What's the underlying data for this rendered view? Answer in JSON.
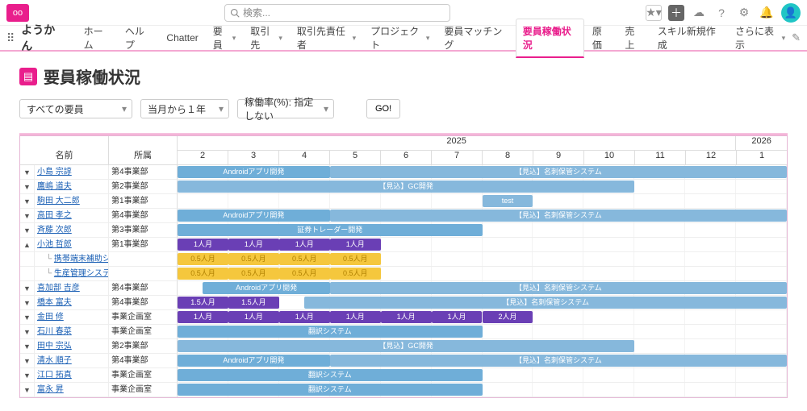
{
  "topbar": {
    "search_placeholder": "検索..."
  },
  "nav": {
    "app_name": "ようかん",
    "items": [
      "ホーム",
      "ヘルプ",
      "Chatter",
      "要員",
      "取引先",
      "取引先責任者",
      "プロジェクト",
      "要員マッチング",
      "要員稼働状況",
      "原価",
      "売上",
      "スキル新規作成",
      "さらに表示"
    ],
    "active_index": 8,
    "dropdown_indices": [
      3,
      4,
      5,
      6,
      12
    ]
  },
  "page_title": "要員稼働状況",
  "filters": {
    "resource": "すべての要員",
    "period": "当月から１年",
    "rate": "稼働率(%): 指定しない",
    "go_label": "GO!"
  },
  "columns": {
    "name": "名前",
    "dept": "所属"
  },
  "years": [
    {
      "label": "2025",
      "span": 11
    },
    {
      "label": "2026",
      "span": 1
    }
  ],
  "months": [
    "2",
    "3",
    "4",
    "5",
    "6",
    "7",
    "8",
    "9",
    "10",
    "11",
    "12",
    "1"
  ],
  "rows": [
    {
      "exp": "▼",
      "name": "小島 宗諄",
      "dept": "第4事業部",
      "bars": [
        {
          "start": 0,
          "span": 3,
          "cls": "blue",
          "label": "Androidアプリ開発"
        },
        {
          "start": 3,
          "span": 9,
          "cls": "blue2",
          "label": "【見込】名刺保管システム"
        }
      ]
    },
    {
      "exp": "▼",
      "name": "鷹嶋 道夫",
      "dept": "第2事業部",
      "bars": [
        {
          "start": 0,
          "span": 9,
          "cls": "blue2",
          "label": "【見込】GC開発"
        }
      ]
    },
    {
      "exp": "▼",
      "name": "駒田 大二郎",
      "dept": "第1事業部",
      "bars": [
        {
          "start": 6,
          "span": 1,
          "cls": "blue2",
          "label": "test"
        }
      ]
    },
    {
      "exp": "▼",
      "name": "高田 孝之",
      "dept": "第4事業部",
      "bars": [
        {
          "start": 0,
          "span": 3,
          "cls": "blue",
          "label": "Androidアプリ開発"
        },
        {
          "start": 3,
          "span": 9,
          "cls": "blue2",
          "label": "【見込】名刺保管システム"
        }
      ]
    },
    {
      "exp": "▼",
      "name": "斉藤 次郎",
      "dept": "第3事業部",
      "bars": [
        {
          "start": 0,
          "span": 6,
          "cls": "blue",
          "label": "証券トレーダー開発"
        }
      ]
    },
    {
      "exp": "▲",
      "name": "小池 哲郎",
      "dept": "第1事業部",
      "bars": [
        {
          "start": 0,
          "span": 1,
          "cls": "purple",
          "label": "1人月"
        },
        {
          "start": 1,
          "span": 1,
          "cls": "purple",
          "label": "1人月"
        },
        {
          "start": 2,
          "span": 1,
          "cls": "purple",
          "label": "1人月"
        },
        {
          "start": 3,
          "span": 1,
          "cls": "purple",
          "label": "1人月"
        }
      ]
    },
    {
      "exp": "",
      "child": true,
      "name": "携帯端末補助システム開発",
      "dept": "",
      "bars": [
        {
          "start": 0,
          "span": 1,
          "cls": "yellow",
          "label": "0.5人月"
        },
        {
          "start": 1,
          "span": 1,
          "cls": "yellow",
          "label": "0.5人月"
        },
        {
          "start": 2,
          "span": 1,
          "cls": "yellow",
          "label": "0.5人月"
        },
        {
          "start": 3,
          "span": 1,
          "cls": "yellow",
          "label": "0.5人月"
        }
      ]
    },
    {
      "exp": "",
      "child": true,
      "name": "生産管理システム",
      "dept": "",
      "bars": [
        {
          "start": 0,
          "span": 1,
          "cls": "yellow",
          "label": "0.5人月"
        },
        {
          "start": 1,
          "span": 1,
          "cls": "yellow",
          "label": "0.5人月"
        },
        {
          "start": 2,
          "span": 1,
          "cls": "yellow",
          "label": "0.5人月"
        },
        {
          "start": 3,
          "span": 1,
          "cls": "yellow",
          "label": "0.5人月"
        }
      ]
    },
    {
      "exp": "▼",
      "name": "喜加部 吉彦",
      "dept": "第4事業部",
      "bars": [
        {
          "start": 0.5,
          "span": 2.5,
          "cls": "blue",
          "label": "Androidアプリ開発"
        },
        {
          "start": 3,
          "span": 9,
          "cls": "blue2",
          "label": "【見込】名刺保管システム"
        }
      ]
    },
    {
      "exp": "▼",
      "name": "橋本 富夫",
      "dept": "第4事業部",
      "bars": [
        {
          "start": 0,
          "span": 1,
          "cls": "purple",
          "label": "1.5人月"
        },
        {
          "start": 1,
          "span": 1,
          "cls": "purple",
          "label": "1.5人月"
        },
        {
          "start": 2.5,
          "span": 9.5,
          "cls": "blue2",
          "label": "【見込】名刺保管システム"
        }
      ]
    },
    {
      "exp": "▼",
      "name": "金田 修",
      "dept": "事業企画室",
      "bars": [
        {
          "start": 0,
          "span": 1,
          "cls": "purple",
          "label": "1人月"
        },
        {
          "start": 1,
          "span": 1,
          "cls": "purple",
          "label": "1人月"
        },
        {
          "start": 2,
          "span": 1,
          "cls": "purple",
          "label": "1人月"
        },
        {
          "start": 3,
          "span": 1,
          "cls": "purple",
          "label": "1人月"
        },
        {
          "start": 4,
          "span": 1,
          "cls": "purple",
          "label": "1人月"
        },
        {
          "start": 5,
          "span": 1,
          "cls": "purple",
          "label": "1人月"
        },
        {
          "start": 6,
          "span": 1,
          "cls": "purple",
          "label": "2人月"
        }
      ]
    },
    {
      "exp": "▼",
      "name": "石川 春菜",
      "dept": "事業企画室",
      "bars": [
        {
          "start": 0,
          "span": 6,
          "cls": "blue",
          "label": "翻訳システム"
        }
      ]
    },
    {
      "exp": "▼",
      "name": "田中 宗弘",
      "dept": "第2事業部",
      "bars": [
        {
          "start": 0,
          "span": 9,
          "cls": "blue2",
          "label": "【見込】GC開発"
        }
      ]
    },
    {
      "exp": "▼",
      "name": "清水 順子",
      "dept": "第4事業部",
      "bars": [
        {
          "start": 0,
          "span": 3,
          "cls": "blue",
          "label": "Androidアプリ開発"
        },
        {
          "start": 3,
          "span": 9,
          "cls": "blue2",
          "label": "【見込】名刺保管システム"
        }
      ]
    },
    {
      "exp": "▼",
      "name": "江口 拓真",
      "dept": "事業企画室",
      "bars": [
        {
          "start": 0,
          "span": 6,
          "cls": "blue",
          "label": "翻訳システム"
        }
      ]
    },
    {
      "exp": "▼",
      "name": "富永 昇",
      "dept": "事業企画室",
      "bars": [
        {
          "start": 0,
          "span": 6,
          "cls": "blue",
          "label": "翻訳システム"
        }
      ]
    }
  ]
}
